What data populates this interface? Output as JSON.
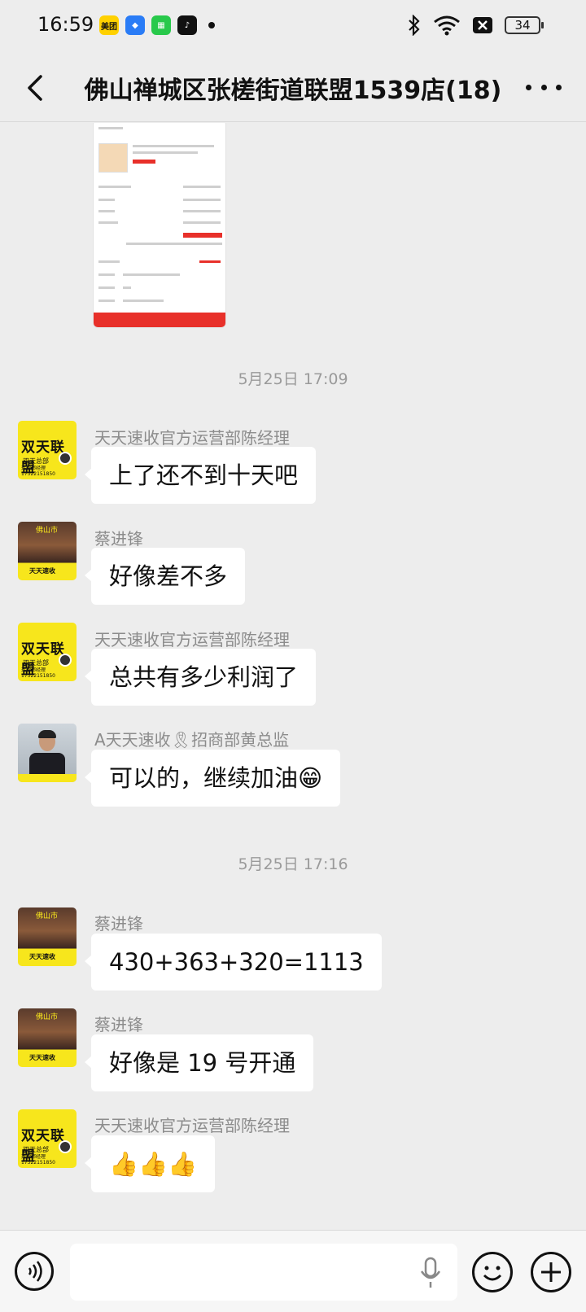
{
  "status_bar": {
    "time": "16:59",
    "battery": "34",
    "app_icons": [
      "meituan-icon",
      "browser-icon",
      "market-icon",
      "tiktok-icon"
    ]
  },
  "header": {
    "title": "佛山禅城区张槎街道联盟1539店(18)"
  },
  "messages": [
    {
      "type": "timestamp",
      "text": "5月25日 17:09"
    },
    {
      "type": "message",
      "sender": "天天速收官方运营部陈经理",
      "text": "上了还不到十天吧",
      "avatar": "yellow"
    },
    {
      "type": "message",
      "sender": "蔡进锋",
      "text": "好像差不多",
      "avatar": "street"
    },
    {
      "type": "message",
      "sender": "天天速收官方运营部陈经理",
      "text": "总共有多少利润了",
      "avatar": "yellow"
    },
    {
      "type": "message",
      "sender": "A天天速收🎗招商部黄总监",
      "text": "可以的，继续加油😁",
      "avatar": "man"
    },
    {
      "type": "timestamp",
      "text": "5月25日 17:16"
    },
    {
      "type": "message",
      "sender": "蔡进锋",
      "text": "430+363+320=1113",
      "avatar": "street"
    },
    {
      "type": "message",
      "sender": "蔡进锋",
      "text": "好像是 19 号开通",
      "avatar": "street"
    },
    {
      "type": "message",
      "sender": "天天速收官方运营部陈经理",
      "text": "👍👍👍",
      "avatar": "yellow"
    }
  ],
  "avatar_text": {
    "yellow_big": "双天联盟",
    "yellow_sub": "双天总部",
    "yellow_tag": "运营部经理 17322151850",
    "street_city": "佛山市",
    "street_bottom": "天天速收"
  },
  "colors": {
    "background": "#ededed",
    "bubble": "#ffffff",
    "brand_yellow": "#f7e61c",
    "accent_red": "#e8302a"
  }
}
